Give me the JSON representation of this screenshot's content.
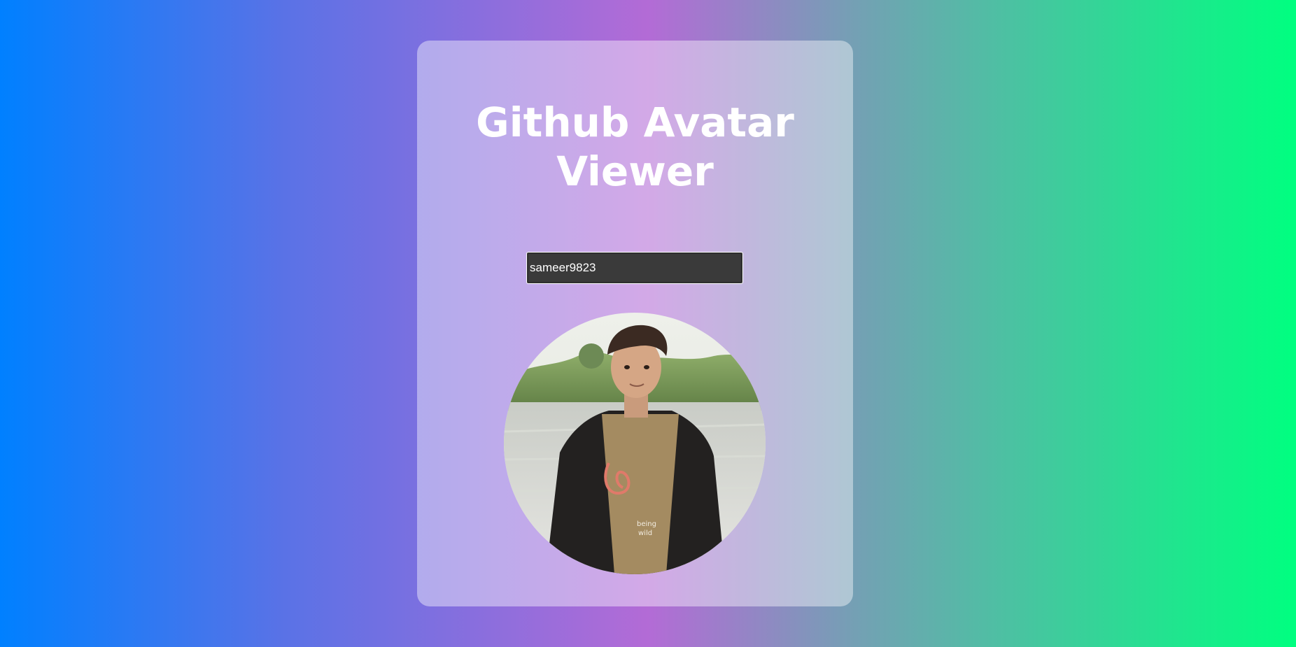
{
  "app": {
    "title": "Github Avatar Viewer"
  },
  "search": {
    "value": "sameer9823",
    "placeholder": ""
  },
  "avatar": {
    "alt": "avatar",
    "tshirt_text": [
      "being",
      "wild"
    ]
  },
  "colors": {
    "gradient_left": "#0080ff",
    "gradient_mid": "#b36bd6",
    "gradient_right": "#00ff80",
    "card": "rgba(255,255,255,0.42)",
    "input_bg": "#3a3a3a"
  }
}
